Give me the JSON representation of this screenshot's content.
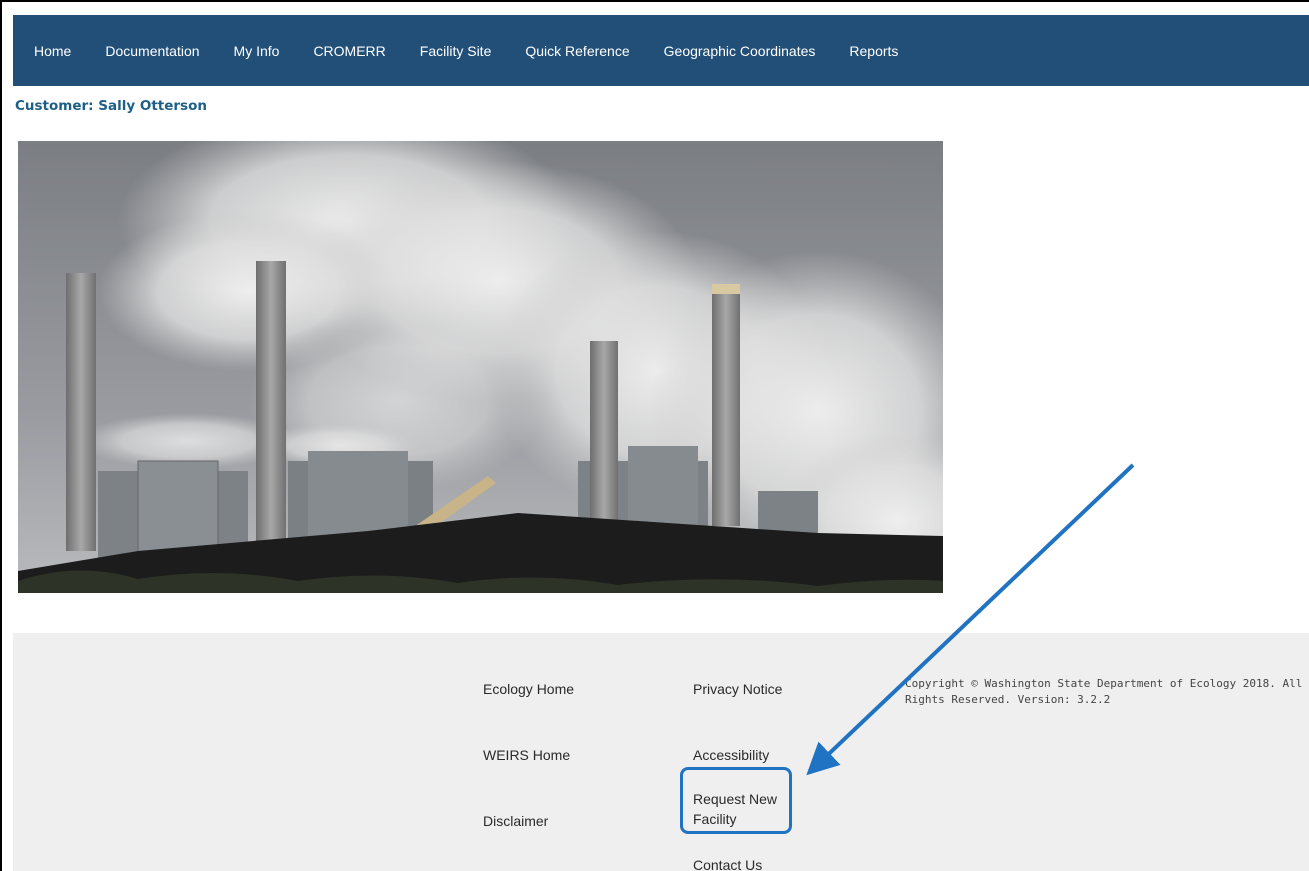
{
  "nav": {
    "items": [
      {
        "label": "Home"
      },
      {
        "label": "Documentation"
      },
      {
        "label": "My Info"
      },
      {
        "label": "CROMERR"
      },
      {
        "label": "Facility Site"
      },
      {
        "label": "Quick Reference"
      },
      {
        "label": "Geographic Coordinates"
      },
      {
        "label": "Reports"
      }
    ]
  },
  "customer": {
    "text": "Customer: Sally Otterson"
  },
  "footer": {
    "ecology_home": "Ecology Home",
    "weirs_home": "WEIRS Home",
    "disclaimer": "Disclaimer",
    "privacy_notice": "Privacy Notice",
    "accessibility": "Accessibility",
    "request_new_facility": "Request New Facility",
    "contact_us": "Contact Us",
    "copyright": "Copyright © Washington State Department of Ecology 2018. All Rights Reserved. Version: 3.2.2"
  },
  "annotation": {
    "color": "#1f73c2"
  }
}
